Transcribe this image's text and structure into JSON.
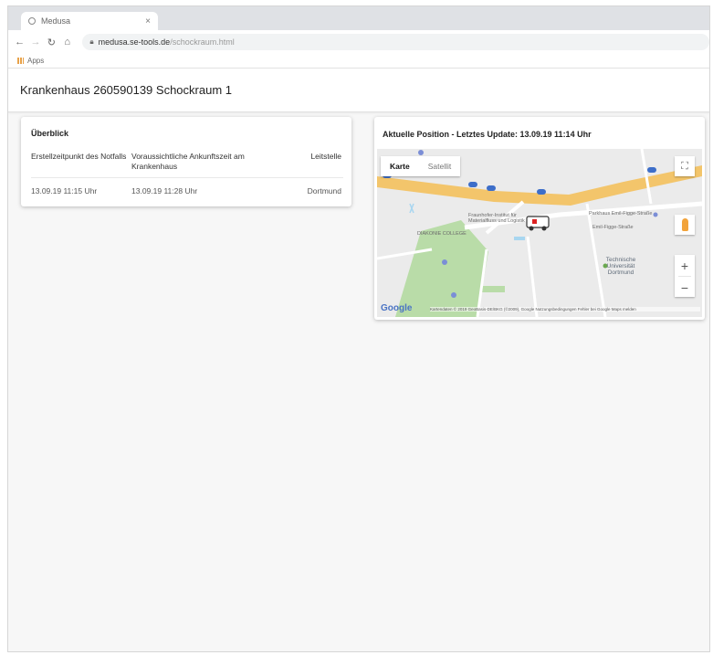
{
  "browser": {
    "tab_title": "Medusa",
    "tab_close": "×",
    "url_domain": "medusa.se-tools.de",
    "url_path": "/schockraum.html",
    "bookmarks_apps": "Apps"
  },
  "header": {
    "title": "Krankenhaus 260590139 Schockraum 1"
  },
  "overview": {
    "title": "Überblick",
    "columns": [
      "Erstellzeitpunkt des Notfalls",
      "Voraussichtliche Ankunftszeit am Krankenhaus",
      "Leitstelle"
    ],
    "rows": [
      [
        "13.09.19 11:15 Uhr",
        "13.09.19 11:28 Uhr",
        "Dortmund"
      ]
    ]
  },
  "position": {
    "title": "Aktuelle Position - Letztes Update: 13.09.19 11:14 Uhr",
    "map_type_options": [
      "Karte",
      "Satellit"
    ],
    "map_type_selected": "Karte",
    "zoom_in": "+",
    "zoom_out": "−",
    "google": "Google",
    "labels": {
      "hub_college": "DIAKONIE COLLEGE",
      "tu": "Technische Universität Dortmund",
      "parking": "Parkhaus Emil-Figge-Straße",
      "hub": "Fraunhofer-Institut für Materialfluss und Logistik",
      "street": "Emil-Figge-Straße"
    },
    "attribution": "Kartendaten © 2019 GeoBasis-DE/BKG (©2009), Google   Nutzungsbedingungen   Fehler bei Google Maps melden"
  },
  "colors": {
    "accent_road": "#f6cf6a",
    "motorway": "#f0b654",
    "park": "#b9dca8",
    "water": "#a8d6f0"
  }
}
